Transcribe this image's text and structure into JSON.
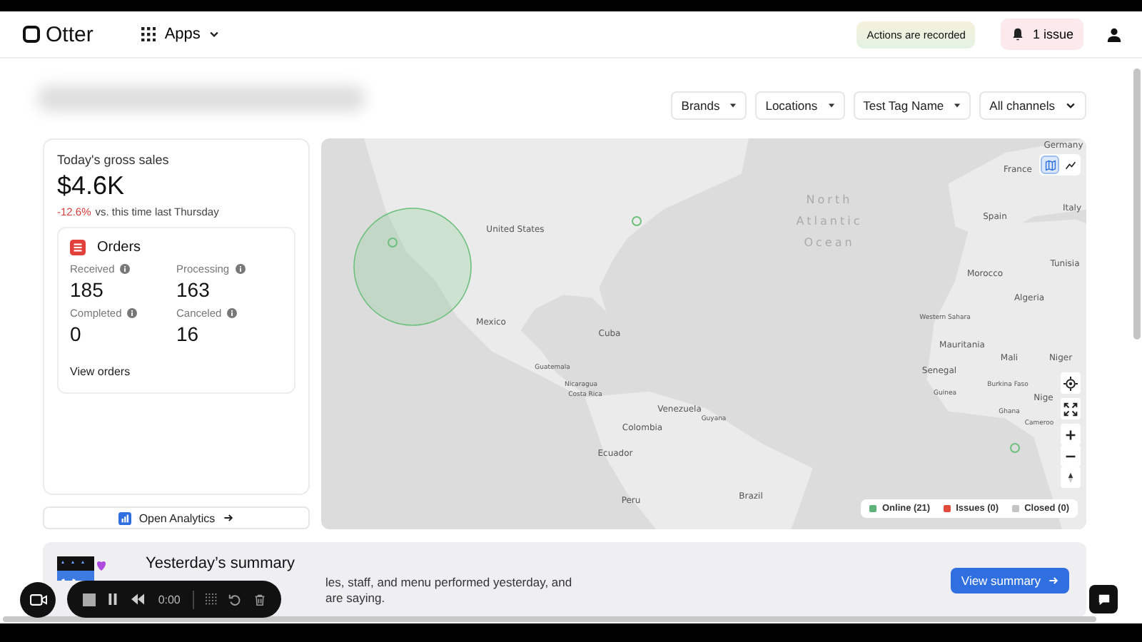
{
  "header": {
    "logo": "Otter",
    "apps_menu": "Apps",
    "recording_notice": "Actions are recorded",
    "issues_button": "1 issue"
  },
  "filters": [
    {
      "label": "Brands",
      "kind": "dropdown"
    },
    {
      "label": "Locations",
      "kind": "dropdown"
    },
    {
      "label": "Test Tag Name",
      "kind": "dropdown"
    },
    {
      "label": "All channels",
      "kind": "menu"
    }
  ],
  "sales": {
    "title": "Today's gross sales",
    "amount": "$4.6K",
    "change": "-12.6%",
    "comparison": "vs. this time last Thursday"
  },
  "orders": {
    "title": "Orders",
    "stats": [
      {
        "label": "Received",
        "value": "185"
      },
      {
        "label": "Processing",
        "value": "163"
      },
      {
        "label": "Completed",
        "value": "0"
      },
      {
        "label": "Canceled",
        "value": "16"
      }
    ],
    "link": "View orders"
  },
  "analytics_button": "Open Analytics",
  "map": {
    "view_toggle": [
      {
        "kind": "map",
        "selected": true
      },
      {
        "kind": "chart",
        "selected": false
      }
    ],
    "labels": [
      {
        "text": "Germany",
        "kind": "country"
      },
      {
        "text": "France",
        "kind": "country"
      },
      {
        "text": "Italy",
        "kind": "country"
      },
      {
        "text": "North Atlantic Ocean",
        "kind": "ocean"
      },
      {
        "text": "Spain",
        "kind": "country"
      },
      {
        "text": "United States",
        "kind": "country"
      },
      {
        "text": "Morocco",
        "kind": "country"
      },
      {
        "text": "Tunisia",
        "kind": "country"
      },
      {
        "text": "Algeria",
        "kind": "country"
      },
      {
        "text": "Mexico",
        "kind": "country"
      },
      {
        "text": "Cuba",
        "kind": "country"
      },
      {
        "text": "Western Sahara",
        "kind": "small"
      },
      {
        "text": "Mauritania",
        "kind": "country"
      },
      {
        "text": "Mali",
        "kind": "country"
      },
      {
        "text": "Niger",
        "kind": "country"
      },
      {
        "text": "Senegal",
        "kind": "country"
      },
      {
        "text": "Guatemala",
        "kind": "small"
      },
      {
        "text": "Nicaragua",
        "kind": "small"
      },
      {
        "text": "Costa Rica",
        "kind": "small"
      },
      {
        "text": "Burkina Faso",
        "kind": "small"
      },
      {
        "text": "Guinea",
        "kind": "small"
      },
      {
        "text": "Nige",
        "kind": "country"
      },
      {
        "text": "Cameroo",
        "kind": "small"
      },
      {
        "text": "Ghana",
        "kind": "small"
      },
      {
        "text": "Venezuela",
        "kind": "country"
      },
      {
        "text": "Guyana",
        "kind": "small"
      },
      {
        "text": "Colombia",
        "kind": "country"
      },
      {
        "text": "Ecuador",
        "kind": "country"
      },
      {
        "text": "Peru",
        "kind": "country"
      },
      {
        "text": "Brazil",
        "kind": "country"
      }
    ],
    "legend": [
      {
        "label": "Online (21)",
        "color": "#5fb37a"
      },
      {
        "label": "Issues (0)",
        "color": "#e04b3c"
      },
      {
        "label": "Closed (0)",
        "color": "#c4c4c4"
      }
    ]
  },
  "summary": {
    "title": "Yesterday’s summary",
    "text_lines": [
      "les, staff, and menu performed yesterday, and",
      "are saying."
    ],
    "button": "View summary"
  },
  "recorder": {
    "time": "0:00"
  }
}
